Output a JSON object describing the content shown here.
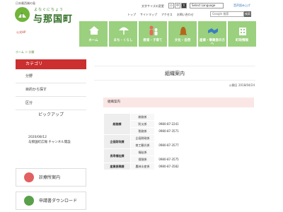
{
  "header": {
    "tagline": "日本最西端の島",
    "kana": "よなぐにちょう",
    "town": "与那国町",
    "official": "公式HP",
    "font_size_label": "文字サイズの変更",
    "font_small": "小",
    "font_medium": "中",
    "font_large": "大",
    "language": "Select Language",
    "voice": "音声読み上げ",
    "links": [
      "トップ",
      "サイトマップ",
      "アクセス",
      "お問い合わせ"
    ],
    "search_placeholder": "Google 検索",
    "search_button": "検索"
  },
  "nav": [
    {
      "label": "ホーム",
      "icon": "home-icon"
    },
    {
      "label": "まち・くらし",
      "icon": "umbrella-icon"
    },
    {
      "label": "教育・子育て",
      "icon": "family-icon"
    },
    {
      "label": "文化・自然",
      "icon": "bell-icon"
    },
    {
      "label": "産業・事業者の方へ",
      "icon": "handshake-icon"
    },
    {
      "label": "町政情報",
      "icon": "building-icon"
    }
  ],
  "breadcrumb": "ホーム ＞ 分類",
  "sidebar": {
    "heading": "カテゴリ",
    "items": [
      "分野",
      "目的から探す",
      "区分"
    ],
    "pickup_title": "ピックアップ",
    "pickup_text": "2020/08/12\n与那国町広報 チャンネル開設",
    "boxes": [
      "診療所案内",
      "申請書ダウンロード"
    ]
  },
  "main": {
    "title": "組織案内",
    "date": "公開日 2018/04/24",
    "section": "組織案内",
    "rows": [
      {
        "dept": "総務課",
        "sec": "総務係",
        "tel": ""
      },
      {
        "dept": "",
        "sec": "防災係",
        "tel": "0980-87-2241"
      },
      {
        "dept": "",
        "sec": "税務係",
        "tel": "0980-87-3571"
      },
      {
        "dept": "企画財政課",
        "sec": "企画財政係",
        "tel": ""
      },
      {
        "dept": "",
        "sec": "商工観光係",
        "tel": "0980-87-3577"
      },
      {
        "dept": "長寿福祉課",
        "sec": "福祉係",
        "tel": ""
      },
      {
        "dept": "",
        "sec": "保険係",
        "tel": "0980-87-3575"
      },
      {
        "dept": "産業振興課",
        "sec": "農林水産係",
        "tel": "0980-87-3582"
      }
    ]
  },
  "colors": {
    "nav_green": "#9bd07e",
    "brand_green": "#2e6e22",
    "category_red": "#cc2f2f",
    "pink_bar": "#fbe6e6"
  }
}
